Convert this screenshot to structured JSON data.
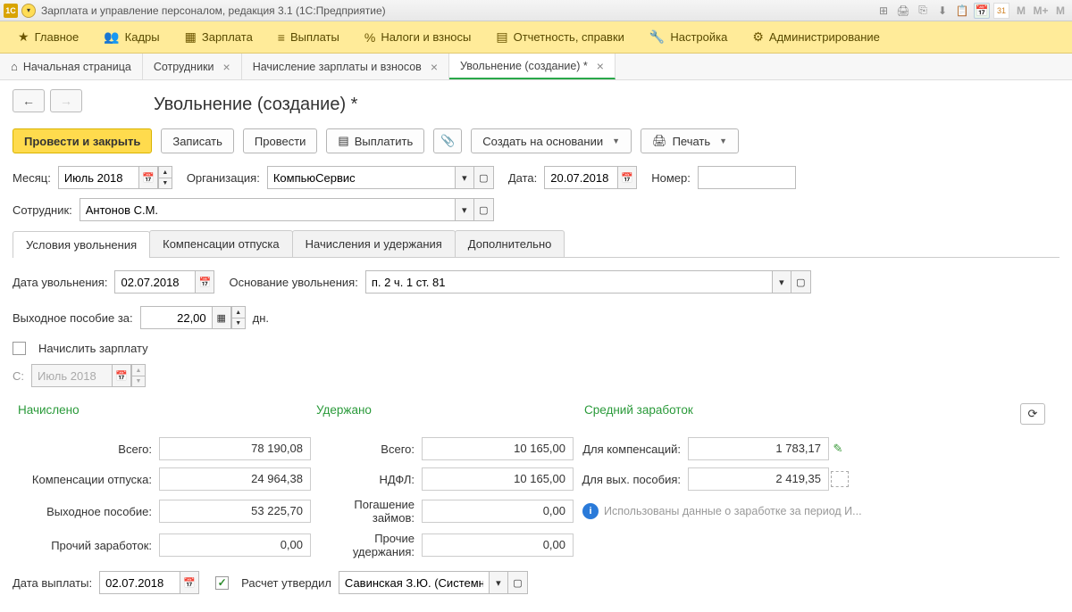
{
  "titlebar": {
    "app_icon_text": "1C",
    "title": "Зарплата и управление персоналом, редакция 3.1  (1С:Предприятие)",
    "right_icons": [
      "⊞",
      "🖨",
      "⎘",
      "⬇",
      "📋",
      "📅",
      "31",
      "M",
      "M+",
      "M"
    ]
  },
  "mainmenu": [
    {
      "icon": "★",
      "label": "Главное"
    },
    {
      "icon": "👥",
      "label": "Кадры"
    },
    {
      "icon": "▦",
      "label": "Зарплата"
    },
    {
      "icon": "≡",
      "label": "Выплаты"
    },
    {
      "icon": "%",
      "label": "Налоги и взносы"
    },
    {
      "icon": "▤",
      "label": "Отчетность, справки"
    },
    {
      "icon": "🔧",
      "label": "Настройка"
    },
    {
      "icon": "⚙",
      "label": "Администрирование"
    }
  ],
  "navtabs": [
    {
      "icon": "⌂",
      "label": "Начальная страница",
      "closable": false,
      "active": false
    },
    {
      "label": "Сотрудники",
      "closable": true,
      "active": false
    },
    {
      "label": "Начисление зарплаты и взносов",
      "closable": true,
      "active": false
    },
    {
      "label": "Увольнение (создание) *",
      "closable": true,
      "active": true
    }
  ],
  "page_title": "Увольнение (создание) *",
  "toolbar": {
    "post_close": "Провести и закрыть",
    "save": "Записать",
    "post": "Провести",
    "pay": "Выплатить",
    "create_based": "Создать на основании",
    "print": "Печать"
  },
  "form": {
    "month_lbl": "Месяц:",
    "month_val": "Июль 2018",
    "org_lbl": "Организация:",
    "org_val": "КомпьюСервис",
    "date_lbl": "Дата:",
    "date_val": "20.07.2018",
    "number_lbl": "Номер:",
    "number_val": "",
    "employee_lbl": "Сотрудник:",
    "employee_val": "Антонов С.М."
  },
  "doctabs": [
    "Условия увольнения",
    "Компенсации отпуска",
    "Начисления и удержания",
    "Дополнительно"
  ],
  "termination": {
    "date_lbl": "Дата увольнения:",
    "date_val": "02.07.2018",
    "reason_lbl": "Основание увольнения:",
    "reason_val": "п. 2 ч. 1 ст. 81",
    "severance_lbl": "Выходное пособие за:",
    "severance_val": "22,00",
    "severance_unit": "дн.",
    "calc_salary_lbl": "Начислить зарплату",
    "from_lbl": "С:",
    "from_val": "Июль 2018"
  },
  "totals": {
    "heads": [
      "Начислено",
      "Удержано",
      "Средний заработок"
    ],
    "accrued": [
      {
        "lbl": "Всего:",
        "val": "78 190,08"
      },
      {
        "lbl": "Компенсации отпуска:",
        "val": "24 964,38"
      },
      {
        "lbl": "Выходное пособие:",
        "val": "53 225,70"
      },
      {
        "lbl": "Прочий заработок:",
        "val": "0,00"
      }
    ],
    "withheld": [
      {
        "lbl": "Всего:",
        "val": "10 165,00"
      },
      {
        "lbl": "НДФЛ:",
        "val": "10 165,00"
      },
      {
        "lbl": "Погашение займов:",
        "val": "0,00"
      },
      {
        "lbl": "Прочие удержания:",
        "val": "0,00"
      }
    ],
    "avg": [
      {
        "lbl": "Для компенсаций:",
        "val": "1 783,17"
      },
      {
        "lbl": "Для вых. пособия:",
        "val": "2 419,35"
      }
    ],
    "info_text": "Использованы данные о заработке за период И..."
  },
  "footer": {
    "paydate_lbl": "Дата выплаты:",
    "paydate_val": "02.07.2018",
    "approved_lbl": "Расчет утвердил",
    "approver_val": "Савинская З.Ю. (Системн"
  }
}
